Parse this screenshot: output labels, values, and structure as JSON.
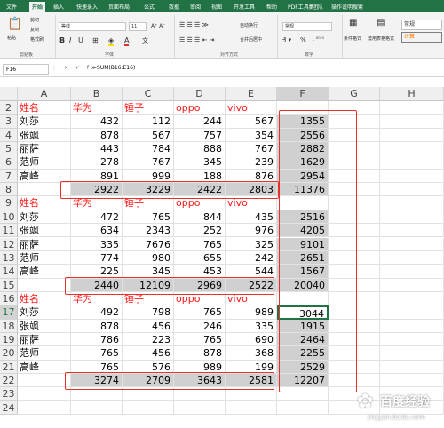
{
  "ribbon_tabs": [
    "文件",
    "开始",
    "插入",
    "快速录入",
    "页面布局",
    "公式",
    "数据",
    "审阅",
    "视图",
    "开发工具",
    "帮助",
    "PDF工具集",
    "团队",
    "操作说明搜索"
  ],
  "ribbon": {
    "clipboard": {
      "paste": "粘贴",
      "cut": "剪切",
      "copy": "复制",
      "format_painter": "格式刷",
      "label": "剪贴板"
    },
    "font": {
      "name": "等线",
      "size": "11",
      "label": "字体"
    },
    "alignment": {
      "wrap": "自动换行",
      "merge": "合并后居中",
      "label": "对齐方式"
    },
    "number": {
      "format": "常规",
      "label": "数字",
      "percent": "%"
    },
    "styles": {
      "conditional": "条件格式",
      "table": "套用表格格式",
      "normal": "常规",
      "calc": "计算"
    }
  },
  "formula_bar": {
    "name_box": "F16",
    "fx": "× ✓ fx",
    "formula": "=SUM(B16:E16)"
  },
  "columns": [
    "A",
    "B",
    "C",
    "D",
    "E",
    "F",
    "G",
    "H"
  ],
  "rows": [
    [
      "姓名",
      "华为",
      "锤子",
      "oppo",
      "vivo",
      "",
      ""
    ],
    [
      "刘莎",
      "432",
      "112",
      "244",
      "567",
      "1355",
      ""
    ],
    [
      "张飒",
      "878",
      "567",
      "757",
      "354",
      "2556",
      ""
    ],
    [
      "丽萨",
      "443",
      "784",
      "888",
      "767",
      "2882",
      ""
    ],
    [
      "范师",
      "278",
      "767",
      "345",
      "239",
      "1629",
      ""
    ],
    [
      "高峰",
      "891",
      "999",
      "188",
      "876",
      "2954",
      ""
    ],
    [
      "",
      "2922",
      "3229",
      "2422",
      "2803",
      "11376",
      ""
    ],
    [
      "姓名",
      "华为",
      "锤子",
      "oppo",
      "vivo",
      "",
      ""
    ],
    [
      "刘莎",
      "472",
      "765",
      "844",
      "435",
      "2516",
      ""
    ],
    [
      "张飒",
      "634",
      "2343",
      "252",
      "976",
      "4205",
      ""
    ],
    [
      "丽萨",
      "335",
      "7676",
      "765",
      "325",
      "9101",
      ""
    ],
    [
      "范师",
      "774",
      "980",
      "655",
      "242",
      "2651",
      ""
    ],
    [
      "高峰",
      "225",
      "345",
      "453",
      "544",
      "1567",
      ""
    ],
    [
      "",
      "2440",
      "12109",
      "2969",
      "2522",
      "20040",
      ""
    ],
    [
      "姓名",
      "华为",
      "锤子",
      "oppo",
      "vivo",
      "",
      ""
    ],
    [
      "刘莎",
      "492",
      "798",
      "765",
      "989",
      "3044",
      ""
    ],
    [
      "张飒",
      "878",
      "456",
      "246",
      "335",
      "1915",
      ""
    ],
    [
      "丽萨",
      "786",
      "223",
      "765",
      "690",
      "2464",
      ""
    ],
    [
      "范师",
      "765",
      "456",
      "878",
      "368",
      "2255",
      ""
    ],
    [
      "高峰",
      "765",
      "576",
      "989",
      "199",
      "2529",
      ""
    ],
    [
      "",
      "3274",
      "2709",
      "3643",
      "2581",
      "12207",
      ""
    ],
    [
      "",
      "",
      "",
      "",
      "",
      "",
      ""
    ],
    [
      "",
      "",
      "",
      "",
      "",
      "",
      ""
    ]
  ],
  "watermark": "百度经验",
  "watermark_url": "jingyan.baidu.com"
}
